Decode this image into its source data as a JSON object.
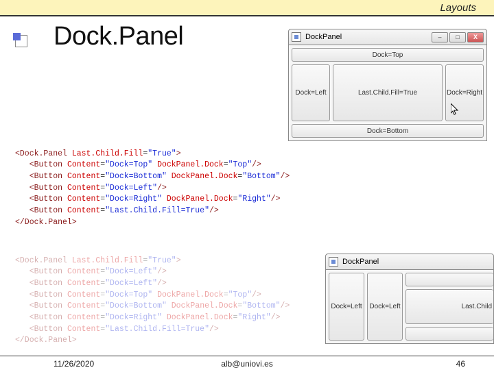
{
  "header": {
    "section": "Layouts"
  },
  "title": "Dock.Panel",
  "window1": {
    "title": "DockPanel",
    "controls": {
      "min": "–",
      "max": "□",
      "close": "X"
    },
    "panes": {
      "top": "Dock=Top",
      "bottom": "Dock=Bottom",
      "left": "Dock=Left",
      "right": "Dock=Right",
      "center": "Last.Child.Fill=True"
    }
  },
  "window2": {
    "title": "DockPanel",
    "panes": {
      "left1": "Dock=Left",
      "left2": "Dock=Left",
      "center": "Last.Child"
    }
  },
  "code1": [
    "<Dock.Panel Last.Child.Fill=\"True\">",
    "   <Button Content=\"Dock=Top\" DockPanel.Dock=\"Top\"/>",
    "   <Button Content=\"Dock=Bottom\" DockPanel.Dock=\"Bottom\"/>",
    "   <Button Content=\"Dock=Left\"/>",
    "   <Button Content=\"Dock=Right\" DockPanel.Dock=\"Right\"/>",
    "   <Button Content=\"Last.Child.Fill=True\"/>",
    "</Dock.Panel>"
  ],
  "code2": [
    "<Dock.Panel Last.Child.Fill=\"True\">",
    "   <Button Content=\"Dock=Left\"/>",
    "   <Button Content=\"Dock=Left\"/>",
    "   <Button Content=\"Dock=Top\" DockPanel.Dock=\"Top\"/>",
    "   <Button Content=\"Dock=Bottom\" DockPanel.Dock=\"Bottom\"/>",
    "   <Button Content=\"Dock=Right\" DockPanel.Dock=\"Right\"/>",
    "   <Button Content=\"Last.Child.Fill=True\"/>",
    "</Dock.Panel>"
  ],
  "footer": {
    "date": "11/26/2020",
    "email": "alb@uniovi.es",
    "page": "46"
  }
}
